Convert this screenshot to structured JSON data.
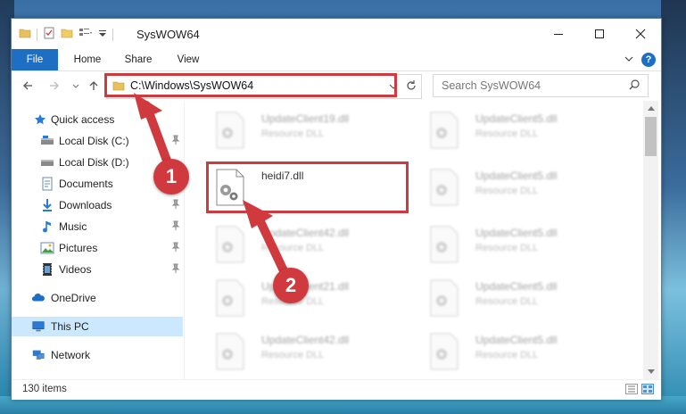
{
  "window": {
    "title": "SysWOW64"
  },
  "ribbon": {
    "tabs": [
      "File",
      "Home",
      "Share",
      "View"
    ]
  },
  "address": {
    "path": "C:\\Windows\\SysWOW64"
  },
  "search": {
    "placeholder": "Search SysWOW64"
  },
  "nav": {
    "items": [
      {
        "label": "Quick access",
        "icon": "star-icon",
        "pinned": false
      },
      {
        "label": "Local Disk (C:)",
        "icon": "drive-icon",
        "pinned": true
      },
      {
        "label": "Local Disk (D:)",
        "icon": "drive-icon",
        "pinned": false
      },
      {
        "label": "Documents",
        "icon": "document-icon",
        "pinned": true
      },
      {
        "label": "Downloads",
        "icon": "download-icon",
        "pinned": true
      },
      {
        "label": "Music",
        "icon": "music-icon",
        "pinned": true
      },
      {
        "label": "Pictures",
        "icon": "pictures-icon",
        "pinned": true
      },
      {
        "label": "Videos",
        "icon": "video-icon",
        "pinned": true
      },
      {
        "label": "OneDrive",
        "icon": "cloud-icon",
        "pinned": false
      },
      {
        "label": "This PC",
        "icon": "computer-icon",
        "pinned": false,
        "selected": true
      },
      {
        "label": "Network",
        "icon": "network-icon",
        "pinned": false
      }
    ]
  },
  "files": {
    "left": [
      {
        "name": "UpdateClient19.dll",
        "type": "Resource DLL"
      },
      {
        "name": "heidi7.dll",
        "type": ""
      },
      {
        "name": "UpdateClient42.dll",
        "type": "Resource DLL"
      },
      {
        "name": "UpdateClient21.dll",
        "type": "Resource DLL"
      },
      {
        "name": "UpdateClient42.dll",
        "type": "Resource DLL"
      }
    ],
    "right": [
      {
        "name": "UpdateClient5.dll",
        "type": "Resource DLL"
      },
      {
        "name": "UpdateClient5.dll",
        "type": "Resource DLL"
      },
      {
        "name": "UpdateClient5.dll",
        "type": "Resource DLL"
      },
      {
        "name": "UpdateClient5.dll",
        "type": "Resource DLL"
      },
      {
        "name": "UpdateClient5.dll",
        "type": "Resource DLL"
      }
    ]
  },
  "status": {
    "item_count": "130 items"
  },
  "annotations": {
    "step1": "1",
    "step2": "2",
    "color": "#d0393d"
  }
}
